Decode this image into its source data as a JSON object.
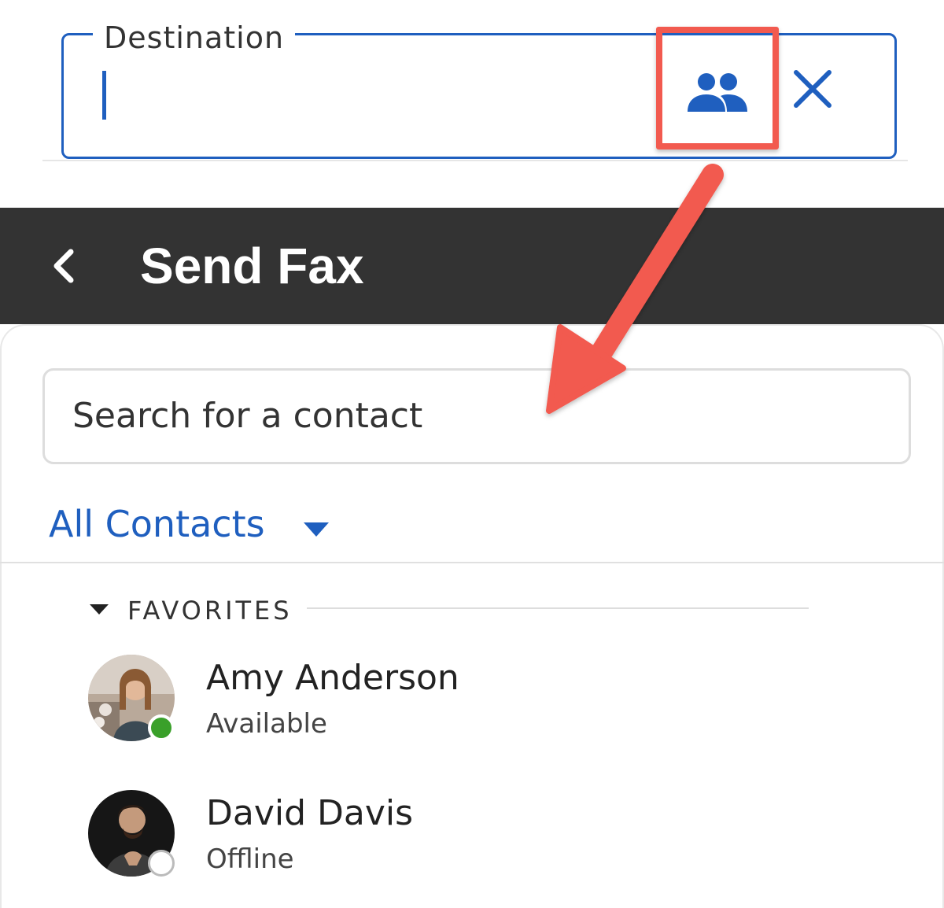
{
  "destination": {
    "label": "Destination",
    "value": ""
  },
  "header": {
    "title": "Send Fax"
  },
  "search": {
    "placeholder": "Search for a contact"
  },
  "filter": {
    "label": "All Contacts"
  },
  "favorites": {
    "section_label": "FAVORITES",
    "contacts": [
      {
        "name": "Amy Anderson",
        "status": "Available",
        "presence_color": "#3aa02a"
      },
      {
        "name": "David Davis",
        "status": "Offline",
        "presence_color": "#ffffff"
      }
    ]
  },
  "colors": {
    "accent": "#1f5fbf",
    "header_bg": "#333333",
    "annotation": "#f25a4f"
  },
  "icons": {
    "contacts": "people-icon",
    "clear": "close-icon",
    "back": "chevron-left-icon",
    "filter": "caret-down-icon",
    "section": "caret-down-icon"
  }
}
